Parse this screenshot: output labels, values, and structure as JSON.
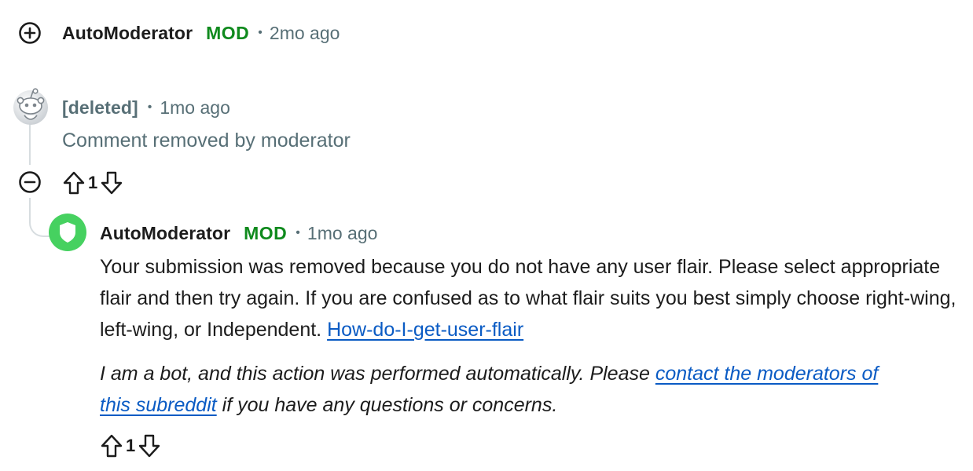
{
  "comment1": {
    "expand_icon": "plus-circle-icon",
    "author": "AutoModerator",
    "mod_badge": "MOD",
    "separator": "•",
    "time": "2mo ago"
  },
  "comment2": {
    "avatar_icon": "snoo-avatar-icon",
    "author": "[deleted]",
    "separator": "•",
    "time": "1mo ago",
    "body": "Comment removed by moderator",
    "collapse_icon": "minus-circle-icon",
    "votes": "1"
  },
  "comment3": {
    "avatar_icon": "shield-avatar-icon",
    "avatar_color": "#46d160",
    "author": "AutoModerator",
    "mod_badge": "MOD",
    "separator": "•",
    "time": "1mo ago",
    "body_prefix": "Your submission was removed because you do not have any user flair. Please select appropriate flair and then try again. If you are confused as to what flair suits you best simply choose right-wing, left-wing, or Independent. ",
    "body_link": "How-do-I-get-user-flair",
    "bot_prefix": "I am a bot, and this action was performed automatically. Please ",
    "bot_link": "contact the moderators of this subreddit",
    "bot_suffix": " if you have any questions or concerns.",
    "votes": "1"
  },
  "colors": {
    "mod_green": "#0f8a1d",
    "link_blue": "#0a5bc4",
    "muted": "#576f76"
  }
}
